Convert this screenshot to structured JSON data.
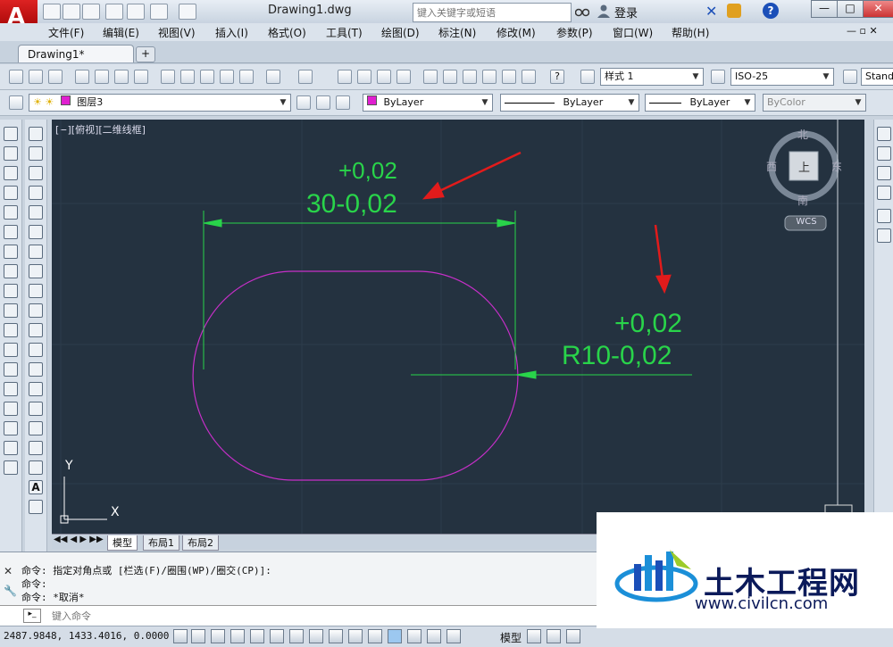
{
  "titlebar": {
    "document": "Drawing1.dwg",
    "search_placeholder": "键入关键字或短语",
    "login": "登录",
    "minimize": "—",
    "restore": "□",
    "close": "✕"
  },
  "menubar": {
    "items": [
      "文件(F)",
      "编辑(E)",
      "视图(V)",
      "插入(I)",
      "格式(O)",
      "工具(T)",
      "绘图(D)",
      "标注(N)",
      "修改(M)",
      "参数(P)",
      "窗口(W)",
      "帮助(H)"
    ]
  },
  "tabs": {
    "active": "Drawing1*",
    "new_tab": "+"
  },
  "toolbar2": {
    "text_style": "样式 1",
    "dim_style": "ISO-25",
    "table_style": "Stand"
  },
  "toolbar3": {
    "layer": "图层3",
    "color": "ByLayer",
    "linetype": "ByLayer",
    "lineweight": "ByLayer",
    "plotstyle": "ByColor"
  },
  "viewport": {
    "label": "[−][俯视][二维线框]",
    "compass": {
      "north": "北",
      "south": "南",
      "east": "东",
      "west": "西",
      "center": "上"
    },
    "wcs": "WCS",
    "ucs_y": "Y",
    "ucs_x": "X",
    "dim_top_tol": "+0,02",
    "dim_top_main": "30-0,02",
    "dim_right_tol": "+0,02",
    "dim_right_main": "R10-0,02"
  },
  "layout_tabs": [
    "模型",
    "布局1",
    "布局2"
  ],
  "command": {
    "lines": [
      "命令: 指定对角点或 [栏选(F)/圈围(WP)/圈交(CP)]:",
      "命令:",
      "命令: *取消*"
    ],
    "input_placeholder": "键入命令"
  },
  "status": {
    "coords": "2487.9848, 1433.4016, 0.0000",
    "model_label": "模型"
  },
  "watermark": {
    "title": "土木工程网",
    "url": "www.civilcn.com"
  },
  "colors": {
    "viewport_bg": "#243240",
    "dimension": "#29d44a",
    "geometry": "#c62fc8",
    "arrow": "#e21b1b"
  }
}
